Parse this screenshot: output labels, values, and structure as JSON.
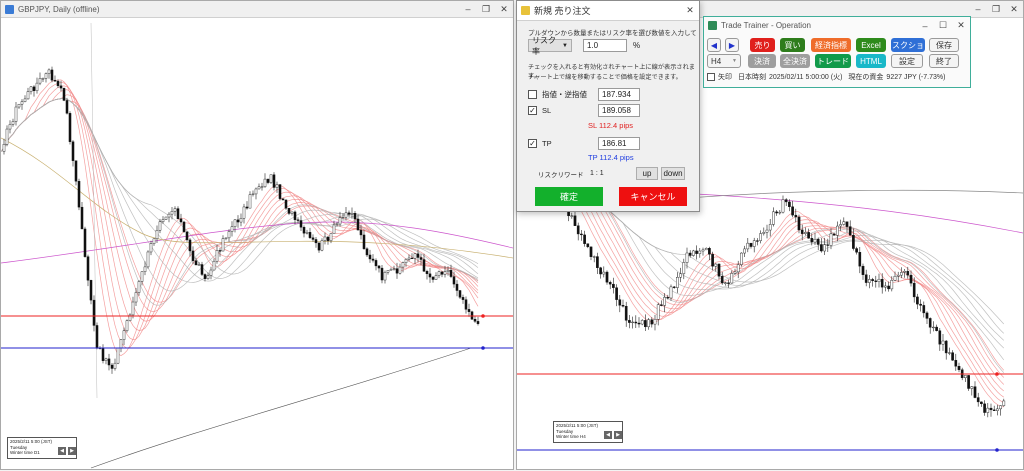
{
  "left_window": {
    "title": "GBPJPY, Daily (offline)",
    "info": {
      "line1": "2025/2/11 5:00 (JST)",
      "line2": "Tuesday",
      "line3": "Winter time",
      "line3_value": "D1"
    }
  },
  "right_window": {
    "title": "",
    "info": {
      "line1": "2025/2/11 5:00 (JST)",
      "line2": "Tuesday",
      "line3": "Winter time",
      "line3_value": "H4"
    }
  },
  "order_dialog": {
    "title": "新規 売り注文",
    "instruction": "プルダウンから数量またはリスク率を選び数値を入力してください。",
    "risk_select": "リスク率",
    "risk_value": "1.0",
    "risk_unit": "%",
    "note_line1": "チェックを入れると有効化されチャート上に線が表示されます。",
    "note_line2": "チャート上で線を移動することで価格を設定できます。",
    "limit_label": "指値・逆指値",
    "limit_value": "187.934",
    "sl_label": "SL",
    "sl_value": "189.058",
    "sl_pips": "SL 112.4 pips",
    "tp_label": "TP",
    "tp_value": "186.81",
    "tp_pips": "TP 112.4 pips",
    "rr_label": "リスクリワード",
    "rr_value": "1 : 1",
    "up_label": "up",
    "down_label": "down",
    "confirm_label": "確定",
    "cancel_label": "キャンセル"
  },
  "operation": {
    "title": "Trade Trainer - Operation",
    "buttons": {
      "sell": "売り",
      "buy": "買い",
      "econ": "経済指標",
      "excel": "Excel",
      "screenshot": "スクショ",
      "save": "保存",
      "settle": "決済",
      "settle_all": "全決済",
      "trade": "トレード",
      "html": "HTML",
      "settings": "設定",
      "exit": "終了"
    },
    "timeframe": "H4",
    "status": {
      "arrow_label": "矢印",
      "time_label": "日本時刻",
      "datetime": "2025/02/11 5:00:00 (火)",
      "funds_label": "現在の資金",
      "funds_value": "9227 JPY (-7.73%)"
    },
    "colors": {
      "sell": "#e0201c",
      "buy": "#2e7d1c",
      "econ": "#ef6c2a",
      "excel": "#2e8b1c",
      "screenshot": "#2f6fd6",
      "trade": "#119a4a",
      "html": "#19b8c8",
      "accent": "#3fae9a"
    }
  }
}
